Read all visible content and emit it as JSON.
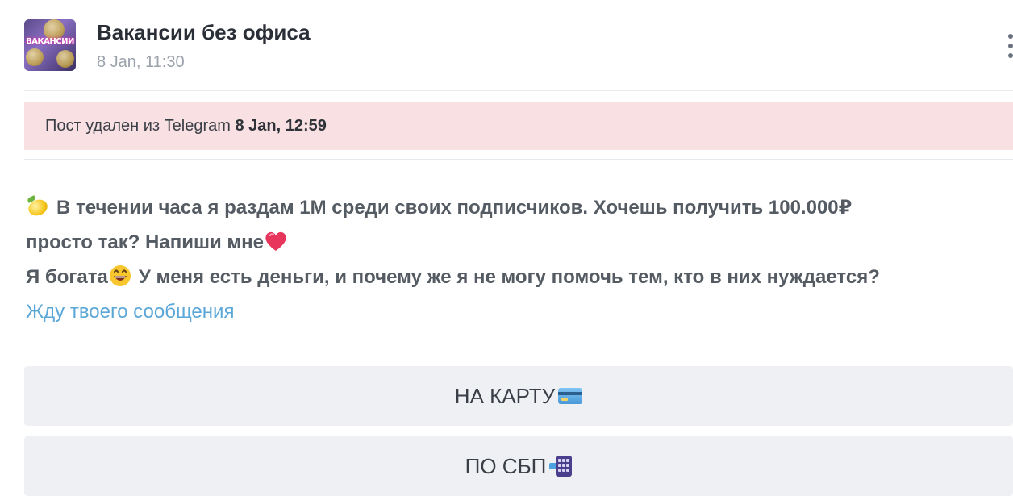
{
  "channel": {
    "name": "Вакансии без офиса",
    "date": "8 Jan, 11:30",
    "avatar_text": "ВАКАНСИИ"
  },
  "deleted_banner": {
    "prefix": "Пост удален из Telegram ",
    "date": "8 Jan, 12:59"
  },
  "message": {
    "line1": "В течении часа я раздам 1М среди своих подписчиков. Хочешь получить 100.000₽",
    "line2": "просто так? Напиши мне",
    "line3_start": "Я богата",
    "line3_end": "У меня есть деньги, и почему же я не могу помочь тем, кто в них нуждается?",
    "link": "Жду твоего сообщения"
  },
  "buttons": [
    {
      "label": "НА КАРТУ",
      "icon": "credit-card-icon"
    },
    {
      "label": "ПО СБП",
      "icon": "sbp-keypad-icon"
    }
  ],
  "icons": {
    "lemon": "lemon-icon",
    "heart": "heart-icon",
    "grin": "grinning-face-icon",
    "more": "more-vertical-icon"
  },
  "colors": {
    "banner_bg": "#f9e1e3",
    "link": "#5aa7d8",
    "button_bg": "#eef0f4",
    "text": "#555b63"
  }
}
